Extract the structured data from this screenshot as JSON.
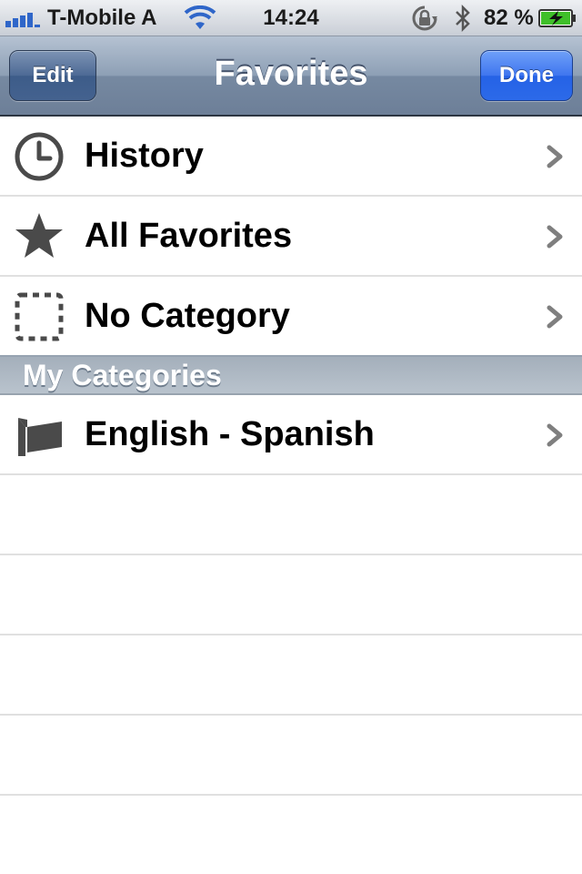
{
  "status_bar": {
    "carrier": "T-Mobile A",
    "time": "14:24",
    "battery_percent": "82 %",
    "icons": [
      "signal-icon",
      "wifi-icon",
      "rotation-lock-icon",
      "bluetooth-icon",
      "battery-charging-icon"
    ]
  },
  "nav": {
    "title": "Favorites",
    "edit_label": "Edit",
    "done_label": "Done"
  },
  "rows": [
    {
      "label": "History",
      "icon": "clock-icon"
    },
    {
      "label": "All Favorites",
      "icon": "star-icon"
    },
    {
      "label": "No Category",
      "icon": "dashed-square-icon"
    }
  ],
  "section": {
    "title": "My Categories",
    "rows": [
      {
        "label": "English - Spanish",
        "icon": "flag-icon"
      }
    ]
  },
  "colors": {
    "nav_gradient_top": "#b5c2d2",
    "nav_gradient_bottom": "#6d7f98",
    "done_button": "#2562e6",
    "edit_button": "#3d5c89",
    "chevron": "#7f7f7f",
    "icon": "#4a4a4a",
    "separator": "#e0e0e0"
  }
}
